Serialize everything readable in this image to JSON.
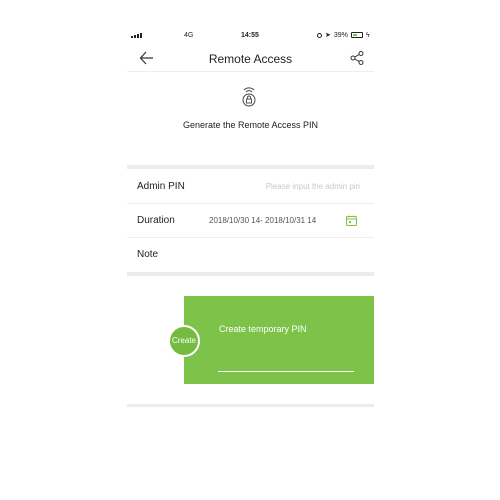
{
  "status_bar": {
    "network": "4G",
    "time": "14:55",
    "battery": "39%"
  },
  "header": {
    "title": "Remote Access",
    "back_icon": "arrow-left-icon",
    "share_icon": "share-icon"
  },
  "generate": {
    "icon": "lock-icon",
    "text": "Generate the Remote Access PIN"
  },
  "form": {
    "admin_pin": {
      "label": "Admin PIN",
      "placeholder": "Please input the admin pin"
    },
    "duration": {
      "label": "Duration",
      "value": "2018/10/30 14- 2018/10/31 14",
      "icon": "calendar-icon"
    },
    "note": {
      "label": "Note"
    }
  },
  "create_card": {
    "button_label": "Create",
    "title": "Create temporary PIN"
  },
  "colors": {
    "accent": "#7dc34a",
    "separator": "#ececec"
  }
}
